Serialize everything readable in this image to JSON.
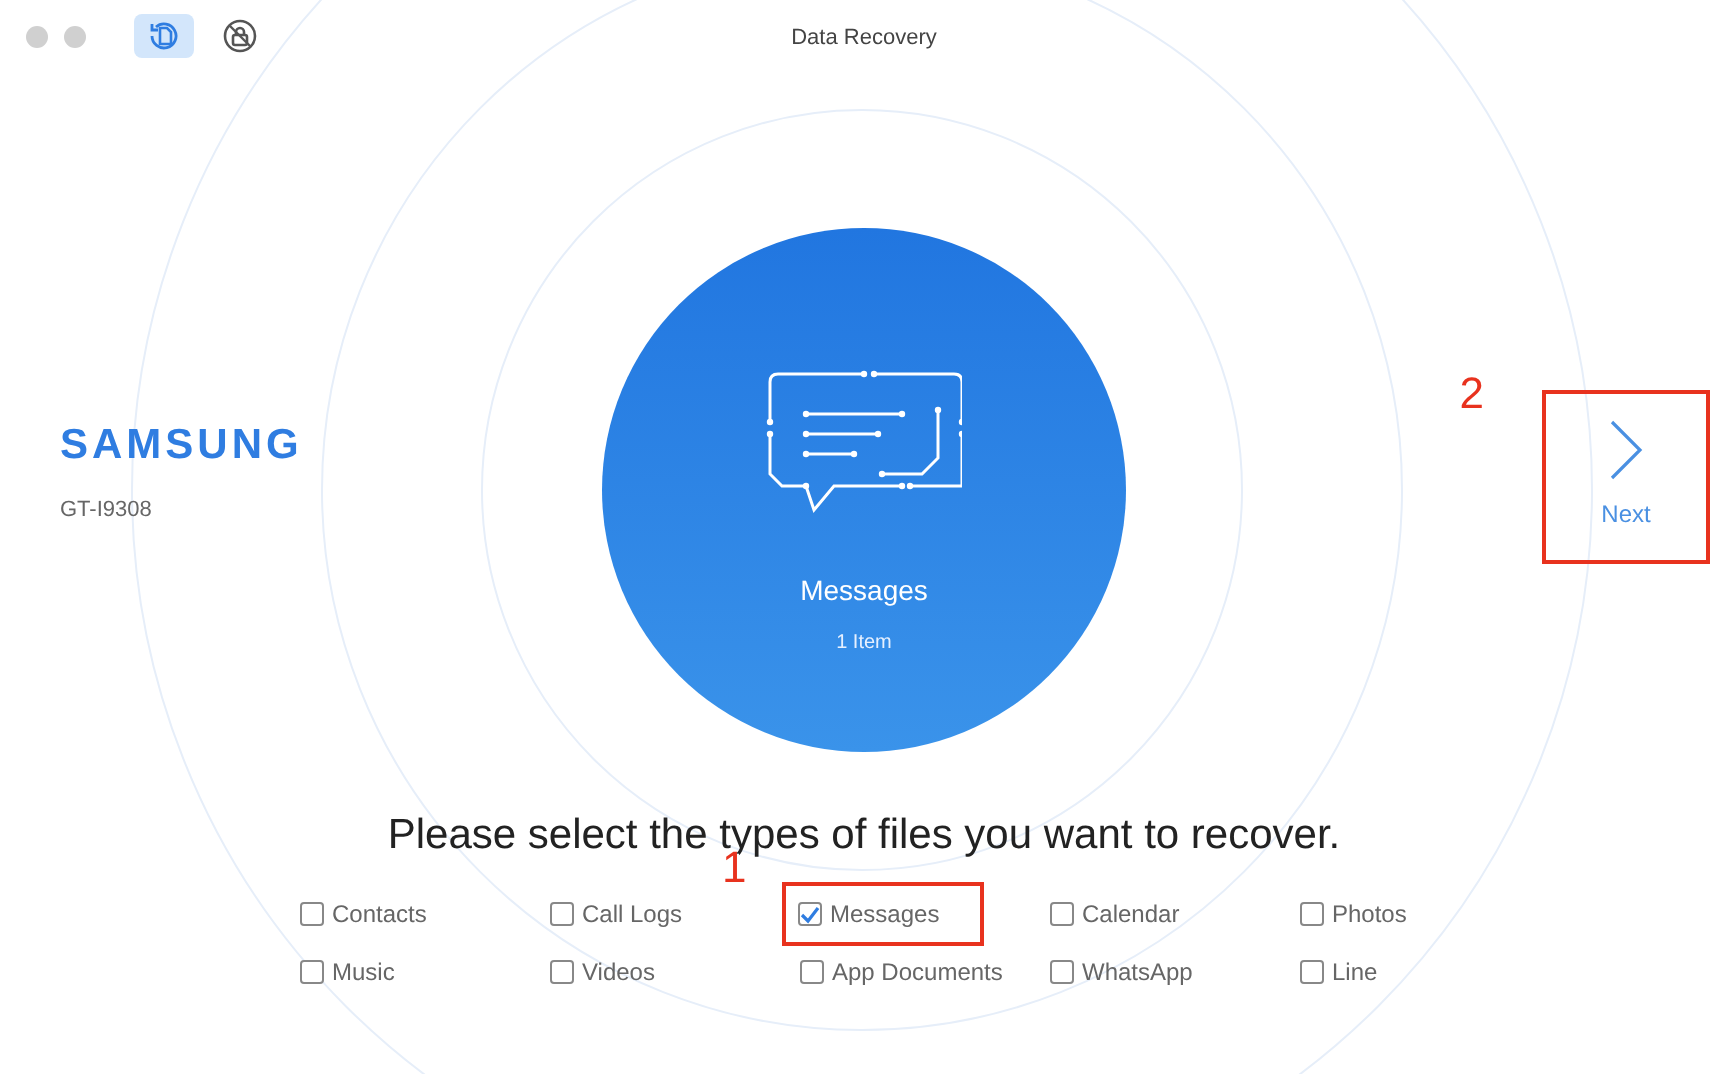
{
  "window": {
    "title": "Data Recovery"
  },
  "toolbar": [
    {
      "kind": "recover",
      "selected": true
    },
    {
      "kind": "lock",
      "selected": false
    }
  ],
  "device": {
    "brand": "SAMSUNG",
    "model": "GT-I9308"
  },
  "preview": {
    "title": "Messages",
    "count": "1 Item"
  },
  "next": {
    "label": "Next",
    "highlighted": true,
    "callout": "2"
  },
  "prompt": "Please select the types of files you want to recover.",
  "file_types": [
    {
      "label": "Contacts",
      "checked": false,
      "highlighted": false
    },
    {
      "label": "Call Logs",
      "checked": false,
      "highlighted": false
    },
    {
      "label": "Messages",
      "checked": true,
      "highlighted": true,
      "callout": "1"
    },
    {
      "label": "Calendar",
      "checked": false,
      "highlighted": false
    },
    {
      "label": "Photos",
      "checked": false,
      "highlighted": false
    },
    {
      "label": "Music",
      "checked": false,
      "highlighted": false
    },
    {
      "label": "Videos",
      "checked": false,
      "highlighted": false
    },
    {
      "label": "App Documents",
      "checked": false,
      "highlighted": false
    },
    {
      "label": "WhatsApp",
      "checked": false,
      "highlighted": false
    },
    {
      "label": "Line",
      "checked": false,
      "highlighted": false
    }
  ]
}
